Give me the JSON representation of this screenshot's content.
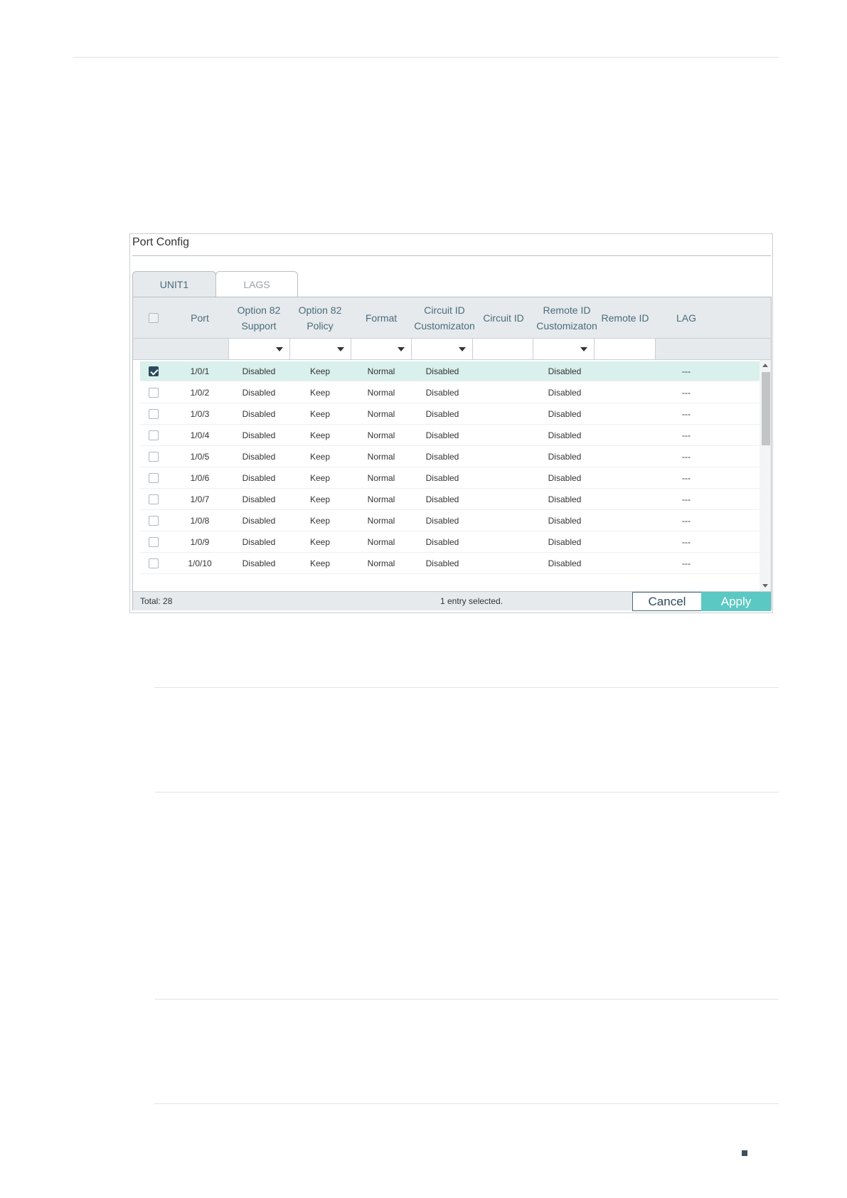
{
  "panel": {
    "title": "Port Config",
    "tabs": [
      {
        "label": "UNIT1",
        "active": true
      },
      {
        "label": "LAGS",
        "active": false
      }
    ]
  },
  "columns": {
    "port": "Port",
    "opt82_support": [
      "Option 82",
      "Support"
    ],
    "opt82_policy": [
      "Option 82",
      "Policy"
    ],
    "format": "Format",
    "circuit_custom": [
      "Circuit ID",
      "Customizaton"
    ],
    "circuit_id": "Circuit ID",
    "remote_custom": [
      "Remote ID",
      "Customizaton"
    ],
    "remote_id": "Remote ID",
    "lag": "LAG"
  },
  "rows": [
    {
      "port": "1/0/1",
      "support": "Disabled",
      "policy": "Keep",
      "format": "Normal",
      "circuit_custom": "Disabled",
      "circuit_id": "",
      "remote_custom": "Disabled",
      "remote_id": "",
      "lag": "---",
      "checked": true
    },
    {
      "port": "1/0/2",
      "support": "Disabled",
      "policy": "Keep",
      "format": "Normal",
      "circuit_custom": "Disabled",
      "circuit_id": "",
      "remote_custom": "Disabled",
      "remote_id": "",
      "lag": "---",
      "checked": false
    },
    {
      "port": "1/0/3",
      "support": "Disabled",
      "policy": "Keep",
      "format": "Normal",
      "circuit_custom": "Disabled",
      "circuit_id": "",
      "remote_custom": "Disabled",
      "remote_id": "",
      "lag": "---",
      "checked": false
    },
    {
      "port": "1/0/4",
      "support": "Disabled",
      "policy": "Keep",
      "format": "Normal",
      "circuit_custom": "Disabled",
      "circuit_id": "",
      "remote_custom": "Disabled",
      "remote_id": "",
      "lag": "---",
      "checked": false
    },
    {
      "port": "1/0/5",
      "support": "Disabled",
      "policy": "Keep",
      "format": "Normal",
      "circuit_custom": "Disabled",
      "circuit_id": "",
      "remote_custom": "Disabled",
      "remote_id": "",
      "lag": "---",
      "checked": false
    },
    {
      "port": "1/0/6",
      "support": "Disabled",
      "policy": "Keep",
      "format": "Normal",
      "circuit_custom": "Disabled",
      "circuit_id": "",
      "remote_custom": "Disabled",
      "remote_id": "",
      "lag": "---",
      "checked": false
    },
    {
      "port": "1/0/7",
      "support": "Disabled",
      "policy": "Keep",
      "format": "Normal",
      "circuit_custom": "Disabled",
      "circuit_id": "",
      "remote_custom": "Disabled",
      "remote_id": "",
      "lag": "---",
      "checked": false
    },
    {
      "port": "1/0/8",
      "support": "Disabled",
      "policy": "Keep",
      "format": "Normal",
      "circuit_custom": "Disabled",
      "circuit_id": "",
      "remote_custom": "Disabled",
      "remote_id": "",
      "lag": "---",
      "checked": false
    },
    {
      "port": "1/0/9",
      "support": "Disabled",
      "policy": "Keep",
      "format": "Normal",
      "circuit_custom": "Disabled",
      "circuit_id": "",
      "remote_custom": "Disabled",
      "remote_id": "",
      "lag": "---",
      "checked": false
    },
    {
      "port": "1/0/10",
      "support": "Disabled",
      "policy": "Keep",
      "format": "Normal",
      "circuit_custom": "Disabled",
      "circuit_id": "",
      "remote_custom": "Disabled",
      "remote_id": "",
      "lag": "---",
      "checked": false
    }
  ],
  "footer": {
    "total": "Total: 28",
    "selected": "1 entry selected.",
    "cancel": "Cancel",
    "apply": "Apply"
  }
}
